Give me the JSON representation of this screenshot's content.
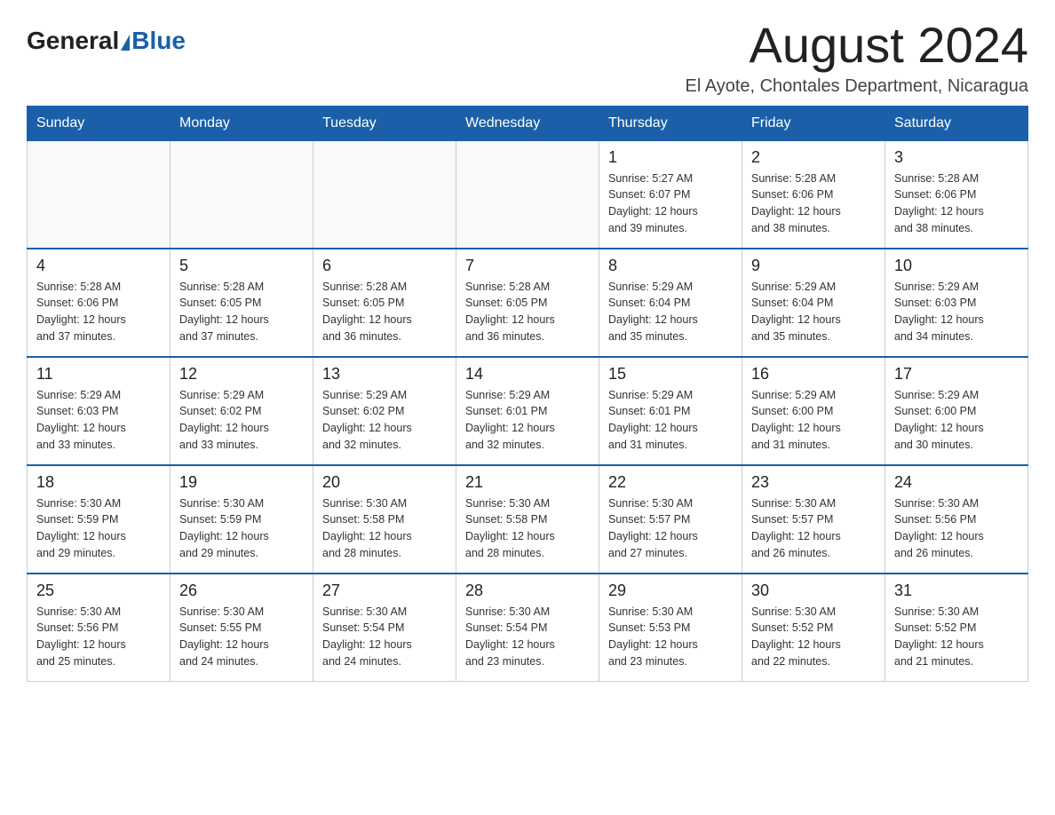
{
  "header": {
    "logo": {
      "general": "General",
      "blue": "Blue"
    },
    "month": "August 2024",
    "location": "El Ayote, Chontales Department, Nicaragua"
  },
  "days_of_week": [
    "Sunday",
    "Monday",
    "Tuesday",
    "Wednesday",
    "Thursday",
    "Friday",
    "Saturday"
  ],
  "weeks": [
    {
      "days": [
        {
          "number": "",
          "info": ""
        },
        {
          "number": "",
          "info": ""
        },
        {
          "number": "",
          "info": ""
        },
        {
          "number": "",
          "info": ""
        },
        {
          "number": "1",
          "info": "Sunrise: 5:27 AM\nSunset: 6:07 PM\nDaylight: 12 hours\nand 39 minutes."
        },
        {
          "number": "2",
          "info": "Sunrise: 5:28 AM\nSunset: 6:06 PM\nDaylight: 12 hours\nand 38 minutes."
        },
        {
          "number": "3",
          "info": "Sunrise: 5:28 AM\nSunset: 6:06 PM\nDaylight: 12 hours\nand 38 minutes."
        }
      ]
    },
    {
      "days": [
        {
          "number": "4",
          "info": "Sunrise: 5:28 AM\nSunset: 6:06 PM\nDaylight: 12 hours\nand 37 minutes."
        },
        {
          "number": "5",
          "info": "Sunrise: 5:28 AM\nSunset: 6:05 PM\nDaylight: 12 hours\nand 37 minutes."
        },
        {
          "number": "6",
          "info": "Sunrise: 5:28 AM\nSunset: 6:05 PM\nDaylight: 12 hours\nand 36 minutes."
        },
        {
          "number": "7",
          "info": "Sunrise: 5:28 AM\nSunset: 6:05 PM\nDaylight: 12 hours\nand 36 minutes."
        },
        {
          "number": "8",
          "info": "Sunrise: 5:29 AM\nSunset: 6:04 PM\nDaylight: 12 hours\nand 35 minutes."
        },
        {
          "number": "9",
          "info": "Sunrise: 5:29 AM\nSunset: 6:04 PM\nDaylight: 12 hours\nand 35 minutes."
        },
        {
          "number": "10",
          "info": "Sunrise: 5:29 AM\nSunset: 6:03 PM\nDaylight: 12 hours\nand 34 minutes."
        }
      ]
    },
    {
      "days": [
        {
          "number": "11",
          "info": "Sunrise: 5:29 AM\nSunset: 6:03 PM\nDaylight: 12 hours\nand 33 minutes."
        },
        {
          "number": "12",
          "info": "Sunrise: 5:29 AM\nSunset: 6:02 PM\nDaylight: 12 hours\nand 33 minutes."
        },
        {
          "number": "13",
          "info": "Sunrise: 5:29 AM\nSunset: 6:02 PM\nDaylight: 12 hours\nand 32 minutes."
        },
        {
          "number": "14",
          "info": "Sunrise: 5:29 AM\nSunset: 6:01 PM\nDaylight: 12 hours\nand 32 minutes."
        },
        {
          "number": "15",
          "info": "Sunrise: 5:29 AM\nSunset: 6:01 PM\nDaylight: 12 hours\nand 31 minutes."
        },
        {
          "number": "16",
          "info": "Sunrise: 5:29 AM\nSunset: 6:00 PM\nDaylight: 12 hours\nand 31 minutes."
        },
        {
          "number": "17",
          "info": "Sunrise: 5:29 AM\nSunset: 6:00 PM\nDaylight: 12 hours\nand 30 minutes."
        }
      ]
    },
    {
      "days": [
        {
          "number": "18",
          "info": "Sunrise: 5:30 AM\nSunset: 5:59 PM\nDaylight: 12 hours\nand 29 minutes."
        },
        {
          "number": "19",
          "info": "Sunrise: 5:30 AM\nSunset: 5:59 PM\nDaylight: 12 hours\nand 29 minutes."
        },
        {
          "number": "20",
          "info": "Sunrise: 5:30 AM\nSunset: 5:58 PM\nDaylight: 12 hours\nand 28 minutes."
        },
        {
          "number": "21",
          "info": "Sunrise: 5:30 AM\nSunset: 5:58 PM\nDaylight: 12 hours\nand 28 minutes."
        },
        {
          "number": "22",
          "info": "Sunrise: 5:30 AM\nSunset: 5:57 PM\nDaylight: 12 hours\nand 27 minutes."
        },
        {
          "number": "23",
          "info": "Sunrise: 5:30 AM\nSunset: 5:57 PM\nDaylight: 12 hours\nand 26 minutes."
        },
        {
          "number": "24",
          "info": "Sunrise: 5:30 AM\nSunset: 5:56 PM\nDaylight: 12 hours\nand 26 minutes."
        }
      ]
    },
    {
      "days": [
        {
          "number": "25",
          "info": "Sunrise: 5:30 AM\nSunset: 5:56 PM\nDaylight: 12 hours\nand 25 minutes."
        },
        {
          "number": "26",
          "info": "Sunrise: 5:30 AM\nSunset: 5:55 PM\nDaylight: 12 hours\nand 24 minutes."
        },
        {
          "number": "27",
          "info": "Sunrise: 5:30 AM\nSunset: 5:54 PM\nDaylight: 12 hours\nand 24 minutes."
        },
        {
          "number": "28",
          "info": "Sunrise: 5:30 AM\nSunset: 5:54 PM\nDaylight: 12 hours\nand 23 minutes."
        },
        {
          "number": "29",
          "info": "Sunrise: 5:30 AM\nSunset: 5:53 PM\nDaylight: 12 hours\nand 23 minutes."
        },
        {
          "number": "30",
          "info": "Sunrise: 5:30 AM\nSunset: 5:52 PM\nDaylight: 12 hours\nand 22 minutes."
        },
        {
          "number": "31",
          "info": "Sunrise: 5:30 AM\nSunset: 5:52 PM\nDaylight: 12 hours\nand 21 minutes."
        }
      ]
    }
  ]
}
